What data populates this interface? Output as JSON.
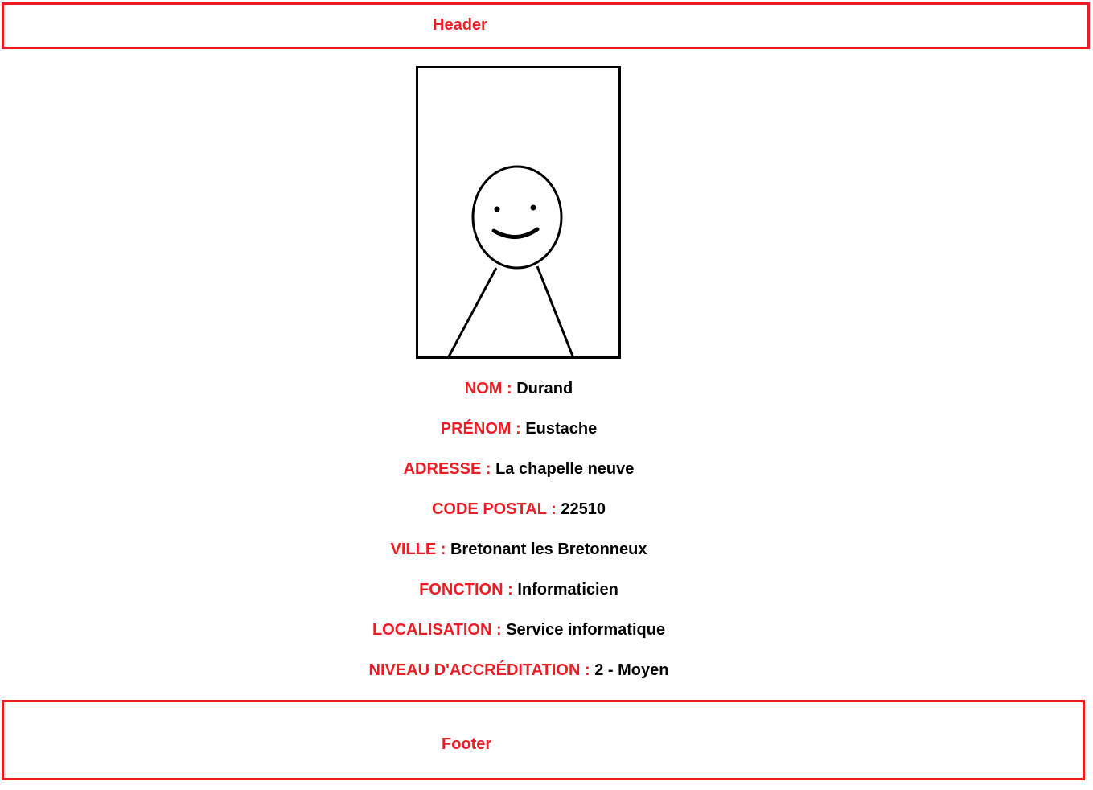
{
  "header": {
    "label": "Header"
  },
  "profile_photo": {
    "icon": "stick-figure-portrait-icon"
  },
  "fields": [
    {
      "label": "NOM : ",
      "value": "Durand"
    },
    {
      "label": "PRÉNOM : ",
      "value": "Eustache"
    },
    {
      "label": "ADRESSE : ",
      "value": "La chapelle neuve"
    },
    {
      "label": "CODE POSTAL : ",
      "value": "22510"
    },
    {
      "label": "VILLE : ",
      "value": "Bretonant les Bretonneux"
    },
    {
      "label": "FONCTION : ",
      "value": "Informaticien"
    },
    {
      "label": "LOCALISATION : ",
      "value": "Service informatique"
    },
    {
      "label": "NIVEAU D'ACCRÉDITATION : ",
      "value": "2 - Moyen"
    }
  ],
  "footer": {
    "label": "Footer"
  },
  "colors": {
    "accent": "#ed1c24",
    "text": "#000000",
    "background": "#ffffff"
  }
}
